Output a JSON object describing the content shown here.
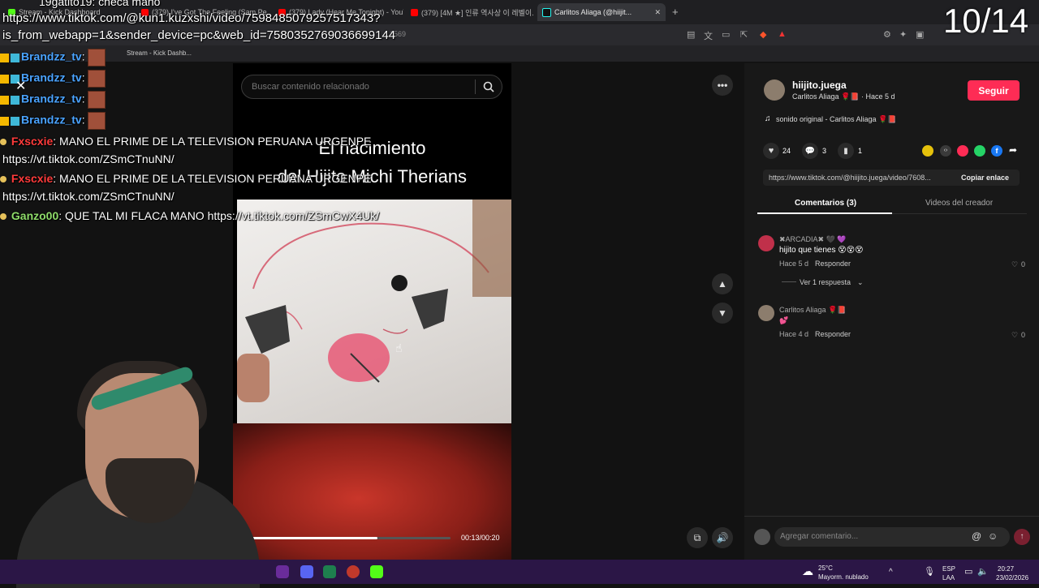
{
  "browser": {
    "tabs": [
      {
        "label": "Stream - Kick Dashboard",
        "active": false
      },
      {
        "label": "(379) I've Got The Feeling (Sam Pe...",
        "active": false
      },
      {
        "label": "(379) Lady (Hear Me Tonight) - YouT...",
        "active": false
      },
      {
        "label": "(379) [4M ★] 인류 역사상 이 레벨이...",
        "active": false
      },
      {
        "label": "Carlitos Aliaga (@hiijit...",
        "active": true
      }
    ],
    "new_tab": "+",
    "address_partial": "1569",
    "bookmarks": [
      "Stream - Kick Dashb..."
    ],
    "icons": [
      "back-icon",
      "forward-icon",
      "reload-icon",
      "translate-icon",
      "cast-icon",
      "share-icon",
      "brave-icon",
      "extensions-icon",
      "music-icon",
      "sidebar-icon",
      "wallet-icon",
      "menu-icon"
    ]
  },
  "overlay": {
    "url_line1": "https://www.tiktok.com/@kun1.kuzxshi/video/7598485079257517343?",
    "url_line2": "is_from_webapp=1&sender_device=pc&web_id=7580352769036699144",
    "counter": "10/14",
    "top_chat": "19gatito19: checa mano",
    "chat": [
      {
        "user": "Brandzz_tv",
        "text": ":",
        "color": "blue"
      },
      {
        "user": "Brandzz_tv",
        "text": ":",
        "color": "blue"
      },
      {
        "user": "Brandzz_tv",
        "text": ":",
        "color": "blue"
      },
      {
        "user": "Brandzz_tv",
        "text": ":",
        "color": "blue"
      },
      {
        "user": "Fxscxie",
        "text": ": MANO EL PRIME DE LA TELEVISION PERUANA URGENPE",
        "color": "red"
      },
      {
        "user": "",
        "text": "https://vt.tiktok.com/ZSmCTnuNN/",
        "color": ""
      },
      {
        "user": "Fxscxie",
        "text": ": MANO EL PRIME DE LA TELEVISION PERUANA URGENPE",
        "color": "red"
      },
      {
        "user": "",
        "text": "https://vt.tiktok.com/ZSmCTnuNN/",
        "color": ""
      },
      {
        "user": "Ganzo00",
        "text": ": QUE TAL MI FLACA MANO https://vt.tiktok.com/ZSmCwX4Uk/",
        "color": "green"
      }
    ]
  },
  "video": {
    "search_placeholder": "Buscar contenido relacionado",
    "title_line1": "El nacimiento",
    "title_line2": "del Hijito Michi Therians",
    "time": "00:13/00:20",
    "progress": 0.65
  },
  "panel": {
    "username": "hiijito.juega",
    "subline": "Carlitos Aliaga 🌹📕 · Hace 5 d",
    "follow": "Seguir",
    "sound": "sonido original - Carlitos Aliaga 🌹📕",
    "likes": "24",
    "comments_count": "3",
    "saves": "1",
    "link": "https://www.tiktok.com/@hiijito.juega/video/7608...",
    "copy_link": "Copiar enlace",
    "tab_comments": "Comentarios (3)",
    "tab_videos": "Videos del creador",
    "comments": [
      {
        "author": "✖ARCADIA✖ 🖤 💜",
        "text": "hijito que tienes 😵😵😵",
        "time": "Hace 5 d",
        "reply": "Responder",
        "likes": "0",
        "replies": "Ver 1 respuesta"
      },
      {
        "author": "Carlitos Aliaga 🌹📕",
        "text": "💕",
        "time": "Hace 4 d",
        "reply": "Responder",
        "likes": "0"
      }
    ],
    "add_comment": "Agregar comentario..."
  },
  "taskbar": {
    "weather_temp": "25°C",
    "weather_desc": "Mayorm. nublado",
    "lang1": "ESP",
    "lang2": "LAA",
    "time": "20:27",
    "date": "23/02/2026"
  }
}
